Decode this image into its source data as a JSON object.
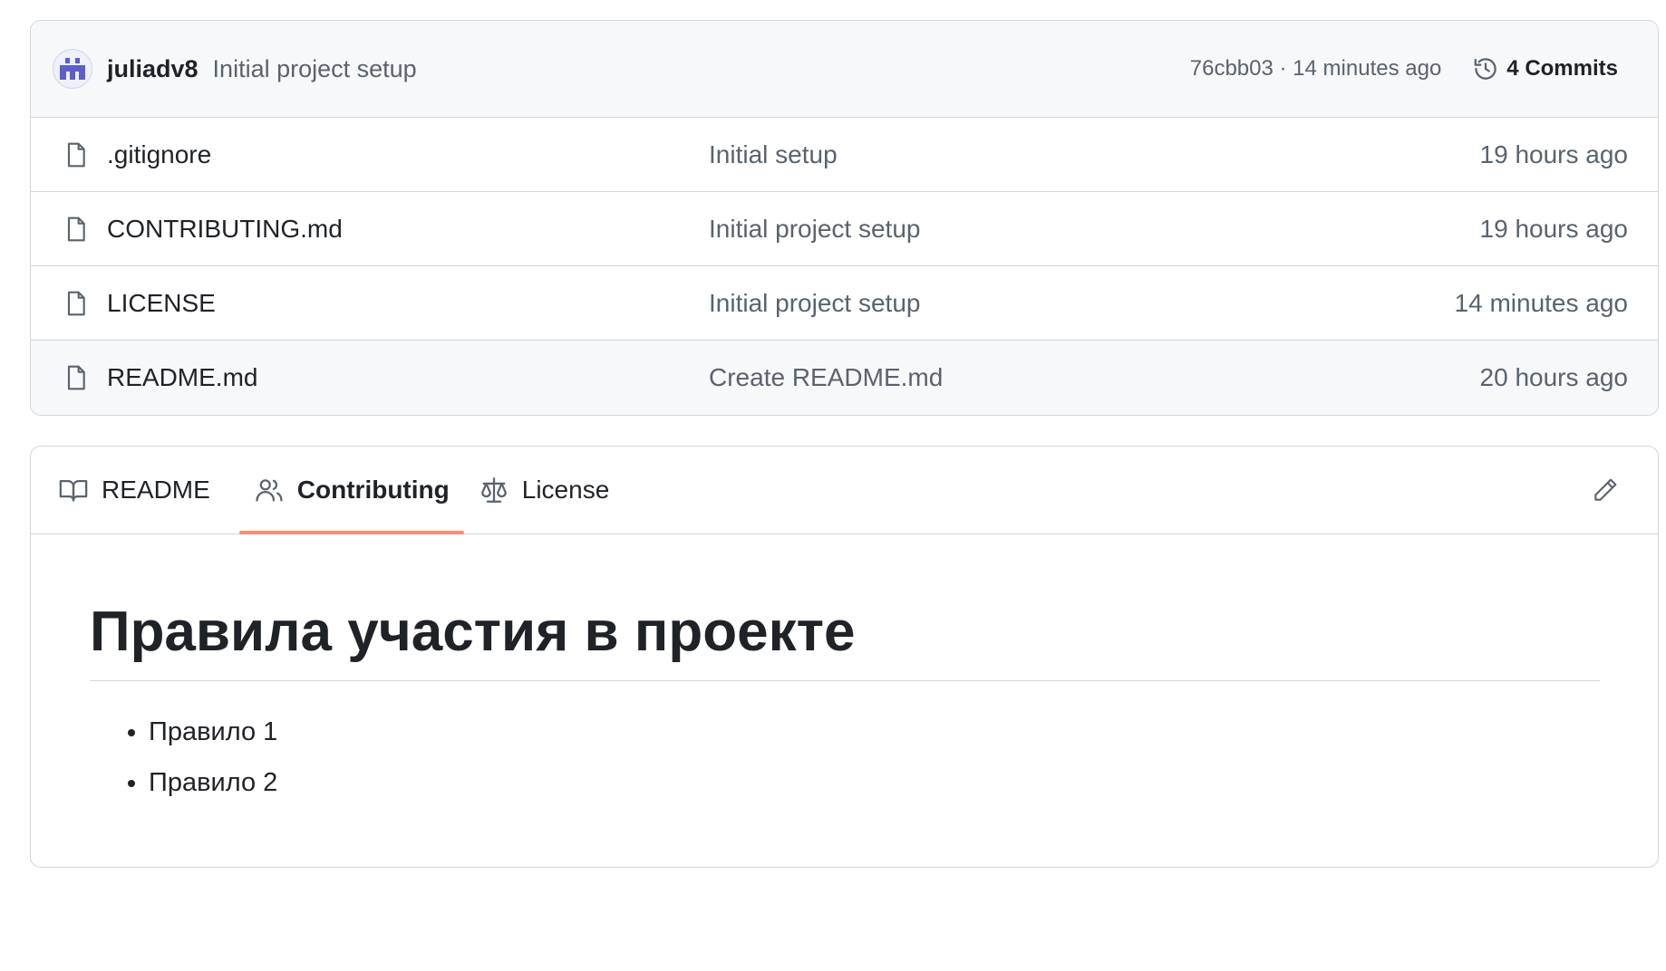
{
  "commit": {
    "author": "juliadv8",
    "message": "Initial project setup",
    "meta": "76cbb03 · 14 minutes ago",
    "commits_label": "4 Commits"
  },
  "files": [
    {
      "name": ".gitignore",
      "commit": "Initial setup",
      "time": "19 hours ago",
      "icon": "file-icon"
    },
    {
      "name": "CONTRIBUTING.md",
      "commit": "Initial project setup",
      "time": "19 hours ago",
      "icon": "file-icon"
    },
    {
      "name": "LICENSE",
      "commit": "Initial project setup",
      "time": "14 minutes ago",
      "icon": "file-icon"
    },
    {
      "name": "README.md",
      "commit": "Create README.md",
      "time": "20 hours ago",
      "icon": "file-icon"
    }
  ],
  "tabs": [
    {
      "label": "README",
      "icon": "book-icon",
      "active": false
    },
    {
      "label": "Contributing",
      "icon": "people-icon",
      "active": true
    },
    {
      "label": "License",
      "icon": "law-icon",
      "active": false
    }
  ],
  "readme": {
    "title": "Правила участия в проекте",
    "items": [
      "Правило 1",
      "Правило 2"
    ]
  },
  "colors": {
    "accent_tab_underline": "#fd8c73",
    "border": "#d0d7de",
    "muted_text": "#59636e",
    "header_bg": "#f6f8fa",
    "avatar": "#5b5fc7"
  }
}
